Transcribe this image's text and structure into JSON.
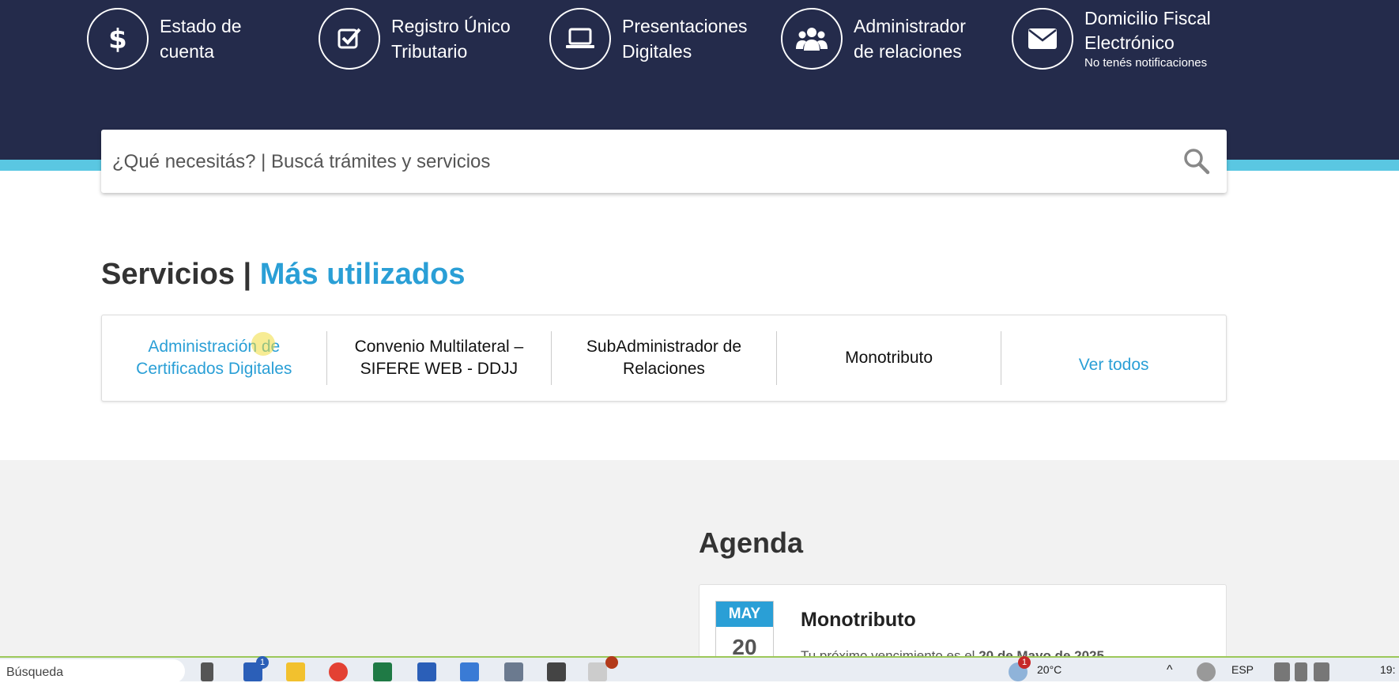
{
  "quick_links": [
    {
      "icon": "dollar-icon",
      "line1": "Estado de",
      "line2": "cuenta",
      "sub": ""
    },
    {
      "icon": "checkbox-icon",
      "line1": "Registro Único",
      "line2": "Tributario",
      "sub": ""
    },
    {
      "icon": "laptop-icon",
      "line1": "Presentaciones",
      "line2": "Digitales",
      "sub": ""
    },
    {
      "icon": "users-icon",
      "line1": "Administrador",
      "line2": "de relaciones",
      "sub": ""
    },
    {
      "icon": "envelope-icon",
      "line1": "Domicilio Fiscal",
      "line2": "Electrónico",
      "sub": "No tenés notificaciones"
    }
  ],
  "search": {
    "placeholder": "¿Qué necesitás? | Buscá trámites y servicios"
  },
  "services": {
    "title_main": "Servicios | ",
    "title_accent": "Más utilizados",
    "items": [
      {
        "label": "Administración de Certificados Digitales"
      },
      {
        "label": "Convenio Multilateral – SIFERE WEB - DDJJ"
      },
      {
        "label": "SubAdministrador de Relaciones"
      },
      {
        "label": "Monotributo"
      }
    ],
    "see_all": "Ver todos"
  },
  "agenda": {
    "title": "Agenda",
    "event": {
      "month": "MAY",
      "day": "20",
      "heading": "Monotributo",
      "text_prefix": "Tu próximo vencimiento es el ",
      "text_bold": "20 de Mayo de 2025"
    }
  },
  "taskbar": {
    "search_label": "Búsqueda",
    "badge_count": "1",
    "weather_badge": "1",
    "temperature": "20°C",
    "language": "ESP",
    "clock": "19:"
  },
  "colors": {
    "header_bg": "#242b4b",
    "accent": "#2a9fd6",
    "strip": "#5ac7e2"
  }
}
